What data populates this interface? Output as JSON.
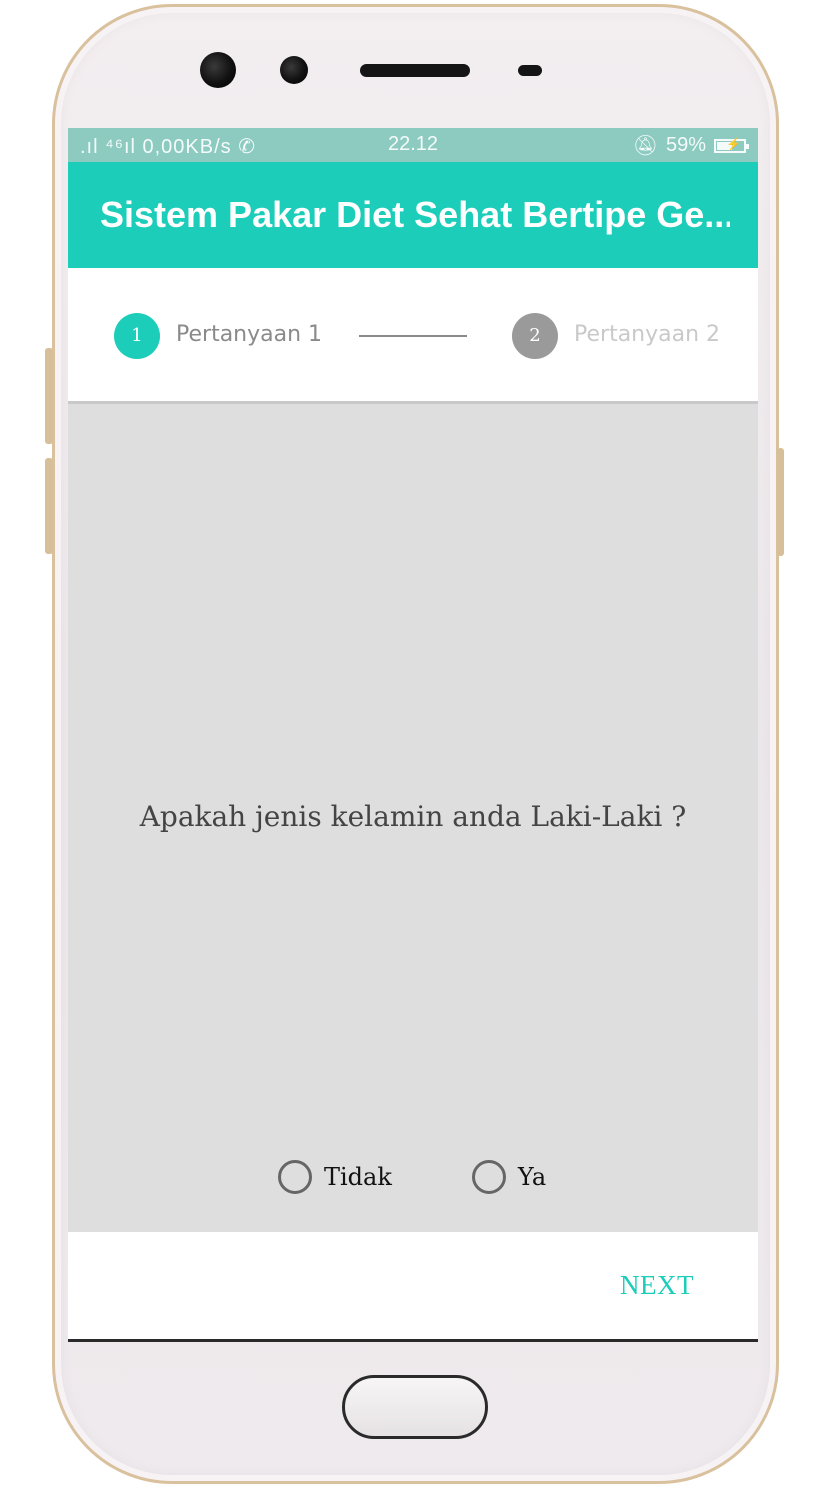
{
  "status_bar": {
    "signal": ".ıl ⁴⁶ıl 0,00KB/s",
    "time": "22.12",
    "battery": "59%",
    "battery_fraction": 0.59,
    "icons": [
      "signal-icon",
      "whatsapp-icon",
      "mute-icon",
      "battery-icon"
    ]
  },
  "app_bar": {
    "title": "Sistem Pakar Diet Sehat Bertipe Ge..."
  },
  "stepper": {
    "steps": [
      {
        "number": "1",
        "label": "Pertanyaan 1",
        "state": "active"
      },
      {
        "number": "2",
        "label": "Pertanyaan 2",
        "state": "inactive"
      }
    ]
  },
  "question": {
    "text": "Apakah jenis kelamin anda Laki-Laki ?"
  },
  "options": [
    {
      "label": "Tidak",
      "selected": false
    },
    {
      "label": "Ya",
      "selected": false
    }
  ],
  "footer": {
    "next_label": "NEXT"
  },
  "colors": {
    "accent": "#1ccdb9",
    "status_bar": "#8dcbc1",
    "content_bg": "#dedede",
    "inactive_step": "#9a9a9a"
  }
}
